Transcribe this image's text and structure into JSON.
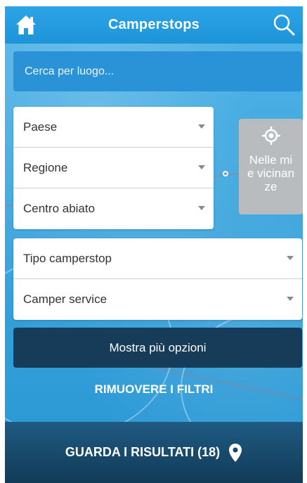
{
  "header": {
    "title": "Camperstops",
    "home_icon": "home-icon",
    "search_icon": "search-icon"
  },
  "search": {
    "placeholder": "Cerca per luogo..."
  },
  "location_selects": [
    {
      "label": "Paese"
    },
    {
      "label": "Regione"
    },
    {
      "label": "Centro abiato"
    }
  ],
  "nearby": {
    "label": "Nelle mie vicinanze",
    "icon": "crosshair-icon"
  },
  "type_selects": [
    {
      "label": "Tipo camperstop"
    },
    {
      "label": "Camper service"
    }
  ],
  "more_options": {
    "label": "Mostra più opzioni"
  },
  "clear_filters": {
    "label": "RIMUOVERE I FILTRI"
  },
  "results": {
    "label": "GUARDA I RISULTATI (18)",
    "icon": "map-pin-icon"
  },
  "colors": {
    "header": "#2ea4e8",
    "search_bg": "#2a92d6",
    "more_button": "#163c59",
    "footer": "#1a4a6d",
    "nearby_button": "#b8bcbe"
  }
}
